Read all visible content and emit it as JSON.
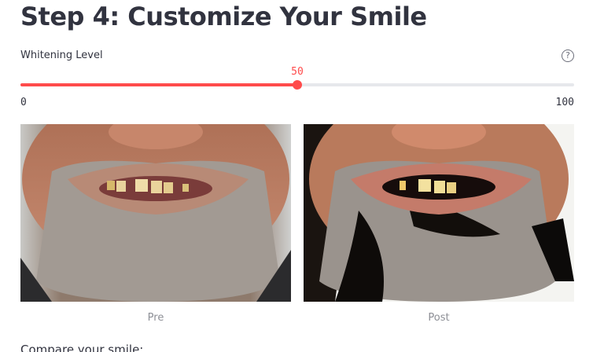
{
  "heading": "Step 4: Customize Your Smile",
  "slider": {
    "label": "Whitening Level",
    "value": 50,
    "min": 0,
    "max": 100,
    "value_text": "50",
    "min_text": "0",
    "max_text": "100"
  },
  "icons": {
    "help": "question-circle-icon"
  },
  "images": [
    {
      "caption": "Pre"
    },
    {
      "caption": "Post"
    }
  ],
  "compare_label": "Compare your smile:",
  "colors": {
    "accent": "#ff4b4b",
    "track": "#e6e8ec",
    "text": "#31333f",
    "caption": "#8d8f96"
  }
}
